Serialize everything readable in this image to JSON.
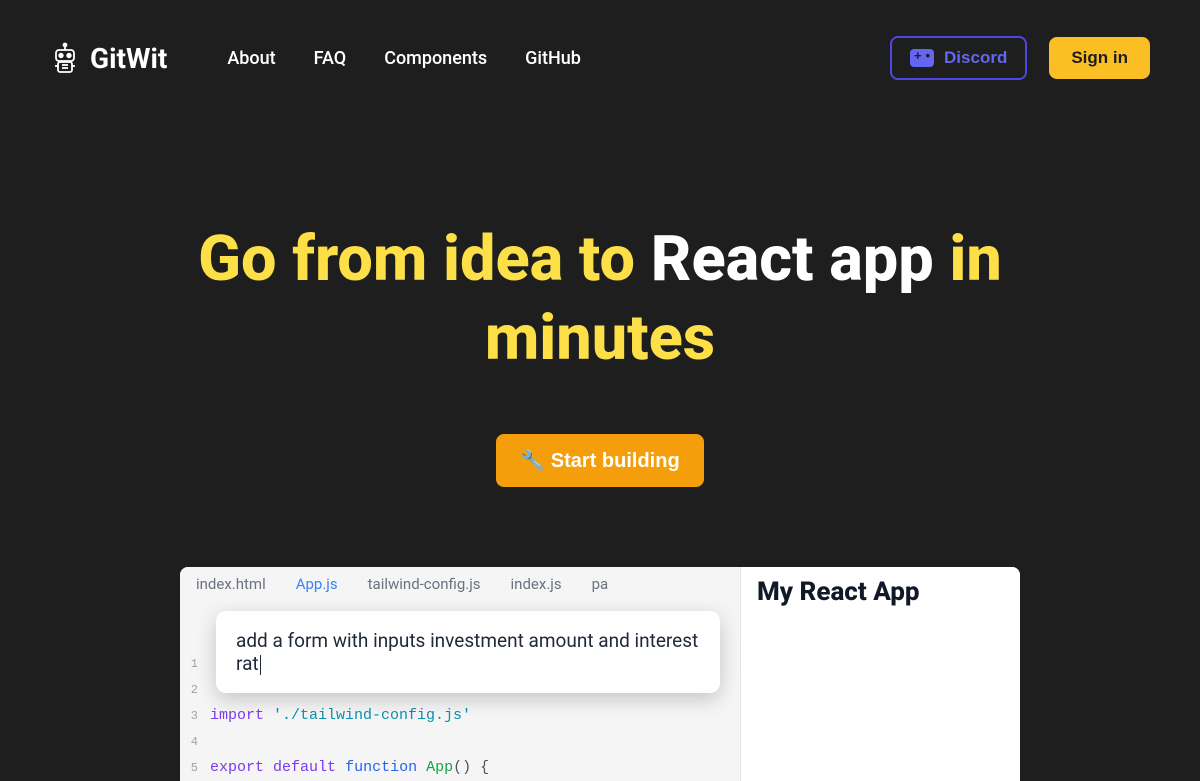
{
  "brand": "GitWit",
  "nav": {
    "about": "About",
    "faq": "FAQ",
    "components": "Components",
    "github": "GitHub"
  },
  "header": {
    "discord": "Discord",
    "signin": "Sign in"
  },
  "hero": {
    "prefix": "Go from idea to ",
    "highlight": "React app",
    "suffix": " in minutes",
    "cta": "🔧 Start building"
  },
  "editor": {
    "tabs": {
      "index_html": "index.html",
      "app_js": "App.js",
      "tailwind": "tailwind-config.js",
      "index_js": "index.js",
      "partial": "pa"
    },
    "prompt": "add a form with inputs investment amount and interest rat",
    "code": {
      "line3": {
        "import": "import",
        "string": "'./tailwind-config.js'"
      },
      "line5": {
        "export": "export",
        "default": "default",
        "function": "function",
        "name": "App",
        "rest": "() {"
      }
    },
    "preview_title": "My React App"
  }
}
